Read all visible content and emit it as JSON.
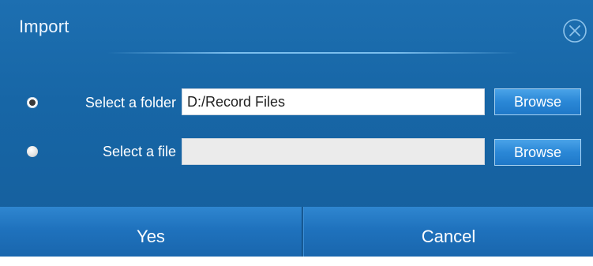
{
  "dialog": {
    "title": "Import",
    "close_icon": "close-circle-icon"
  },
  "options": {
    "folder": {
      "label": "Select a folder",
      "value": "D:/Record Files",
      "selected": true,
      "browse_label": "Browse"
    },
    "file": {
      "label": "Select a file",
      "value": "",
      "selected": false,
      "browse_label": "Browse"
    }
  },
  "footer": {
    "yes_label": "Yes",
    "cancel_label": "Cancel"
  },
  "colors": {
    "dialog_background": "#1766a6",
    "button_accent": "#2a87d6"
  }
}
